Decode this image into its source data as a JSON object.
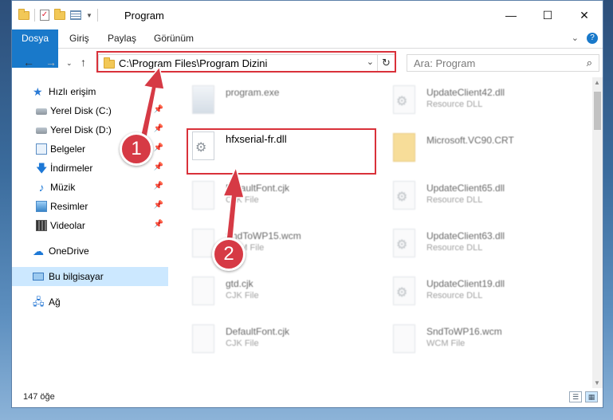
{
  "window": {
    "title": "Program",
    "controls": {
      "minimize": "—",
      "maximize": "☐",
      "close": "✕"
    }
  },
  "ribbon": {
    "tabs": [
      "Dosya",
      "Giriş",
      "Paylaş",
      "Görünüm"
    ]
  },
  "address": {
    "path": "C:\\Program Files\\Program Dizini",
    "search_placeholder": "Ara: Program"
  },
  "nav_pane": {
    "quick_access": "Hızlı erişim",
    "items": [
      {
        "label": "Yerel Disk (C:)",
        "icon": "disk-icon",
        "pinned": true
      },
      {
        "label": "Yerel Disk (D:)",
        "icon": "disk-icon",
        "pinned": true
      },
      {
        "label": "Belgeler",
        "icon": "documents-icon",
        "pinned": true
      },
      {
        "label": "İndirmeler",
        "icon": "downloads-icon",
        "pinned": true
      },
      {
        "label": "Müzik",
        "icon": "music-icon",
        "pinned": true
      },
      {
        "label": "Resimler",
        "icon": "pictures-icon",
        "pinned": true
      },
      {
        "label": "Videolar",
        "icon": "videos-icon",
        "pinned": true
      }
    ],
    "onedrive": "OneDrive",
    "this_pc": "Bu bilgisayar",
    "network": "Ağ"
  },
  "files": [
    {
      "name": "program.exe",
      "type": ""
    },
    {
      "name": "hfxserial-fr.dll",
      "type": ""
    },
    {
      "name": "DefaultFont.cjk",
      "type": "CJK File"
    },
    {
      "name": "SndToWP15.wcm",
      "type": "WCM File"
    },
    {
      "name": "gtd.cjk",
      "type": "CJK File"
    },
    {
      "name": "DefaultFont.cjk",
      "type": "CJK File"
    },
    {
      "name": "UpdateClient42.dll",
      "type": "Resource DLL"
    },
    {
      "name": "Microsoft.VC90.CRT",
      "type": ""
    },
    {
      "name": "UpdateClient65.dll",
      "type": "Resource DLL"
    },
    {
      "name": "UpdateClient63.dll",
      "type": "Resource DLL"
    },
    {
      "name": "UpdateClient19.dll",
      "type": "Resource DLL"
    },
    {
      "name": "SndToWP16.wcm",
      "type": "WCM File"
    }
  ],
  "status": {
    "item_count": "147 öğe"
  },
  "annotations": {
    "step1": "1",
    "step2": "2",
    "color": "#d63a45"
  }
}
